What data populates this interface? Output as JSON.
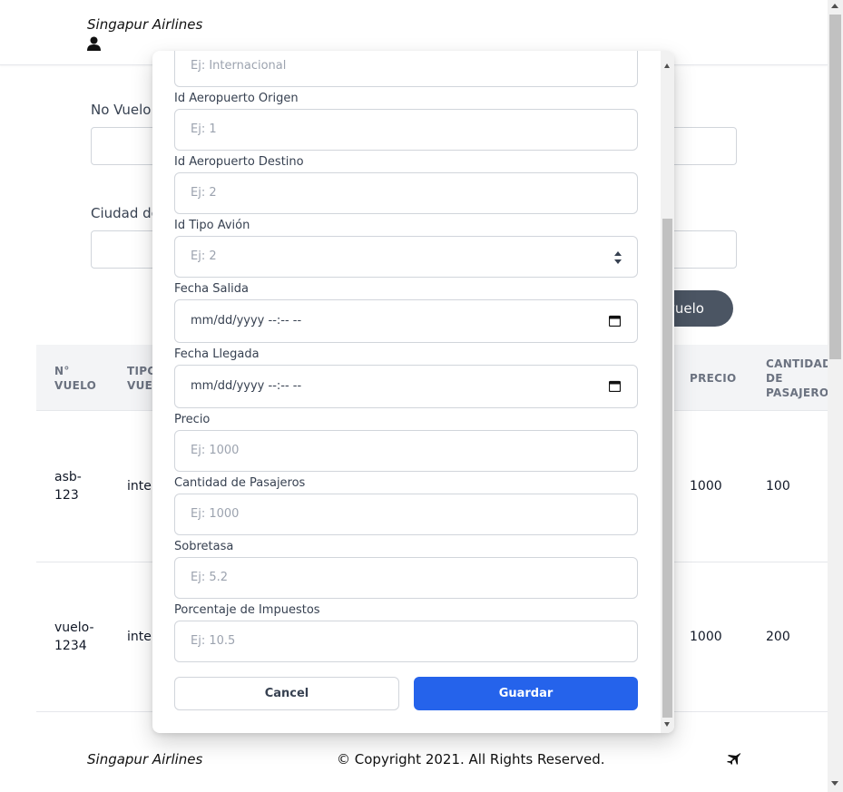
{
  "header": {
    "brand": "Singapur Airlines"
  },
  "background_form": {
    "label_no_vuelo": "No Vuelo",
    "label_ciudad": "Ciudad de",
    "button_partial_label": "vuelo"
  },
  "table": {
    "headers": {
      "col1_line1": "N°",
      "col1_line2": "VUELO",
      "col2_line1": "TIPO",
      "col2_line2": "VUEL",
      "precio": "PRECIO",
      "cantidad_line1": "CANTIDAD",
      "cantidad_line2": "DE",
      "cantidad_line3": "PASAJEROS"
    },
    "rows": [
      {
        "vuelo_line1": "asb-",
        "vuelo_line2": "123",
        "tipo": "inter",
        "precio": "1000",
        "pasajeros": "100"
      },
      {
        "vuelo_line1": "vuelo-",
        "vuelo_line2": "1234",
        "tipo": "inter",
        "precio": "1000",
        "pasajeros": "200"
      }
    ]
  },
  "modal": {
    "top_placeholder": "Ej: Internacional",
    "fields": [
      {
        "label": "Id Aeropuerto Origen",
        "placeholder": "Ej: 1"
      },
      {
        "label": "Id Aeropuerto Destino",
        "placeholder": "Ej: 2"
      },
      {
        "label": "Id Tipo Avión",
        "placeholder": "Ej: 2"
      },
      {
        "label": "Fecha Salida",
        "value": "mm/dd/yyyy --:-- --"
      },
      {
        "label": "Fecha Llegada",
        "value": "mm/dd/yyyy --:-- --"
      },
      {
        "label": "Precio",
        "placeholder": "Ej: 1000"
      },
      {
        "label": "Cantidad de Pasajeros",
        "placeholder": "Ej: 1000"
      },
      {
        "label": "Sobretasa",
        "placeholder": "Ej: 5.2"
      },
      {
        "label": "Porcentaje de Impuestos",
        "placeholder": "Ej: 10.5"
      }
    ],
    "cancel_label": "Cancel",
    "save_label": "Guardar"
  },
  "footer": {
    "brand": "Singapur Airlines",
    "copyright": "© Copyright 2021. All Rights Reserved.",
    "icon": "plane-icon"
  },
  "colors": {
    "primary": "#2563eb",
    "dark_button": "#4b5563",
    "table_header_bg": "#f3f4f6"
  },
  "icons": [
    "user-icon",
    "plane-icon",
    "calendar-icon",
    "spinner-icon"
  ]
}
